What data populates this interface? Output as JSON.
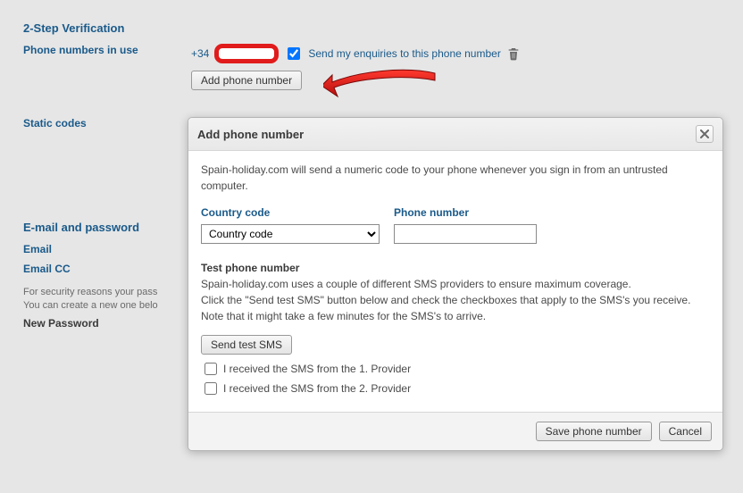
{
  "sections": {
    "tsv_title": "2-Step Verification",
    "phones_label": "Phone numbers in use",
    "static_label": "Static codes",
    "ep_title": "E-mail and password",
    "email_label": "Email",
    "emailcc_label": "Email CC",
    "hint1": "For security reasons your pass",
    "hint2": "You can create a new one belo",
    "newpw_label": "New Password"
  },
  "phone_row": {
    "dial": "+34",
    "send_enquiries": "Send my enquiries to this phone number",
    "add_btn": "Add phone number"
  },
  "dialog": {
    "title": "Add phone number",
    "desc": "Spain-holiday.com will send a numeric code to your phone whenever you sign in from an untrusted computer.",
    "cc_label": "Country code",
    "cc_placeholder": "Country code",
    "pn_label": "Phone number",
    "test_head": "Test phone number",
    "test_p1": "Spain-holiday.com uses a couple of different SMS providers to ensure maximum coverage.",
    "test_p2": "Click the \"Send test SMS\" button below and check the checkboxes that apply to the SMS's you receive.",
    "test_p3": "Note that it might take a few minutes for the SMS's to arrive.",
    "send_btn": "Send test SMS",
    "recv1": "I received the SMS from the 1. Provider",
    "recv2": "I received the SMS from the 2. Provider",
    "save_btn": "Save phone number",
    "cancel_btn": "Cancel"
  }
}
